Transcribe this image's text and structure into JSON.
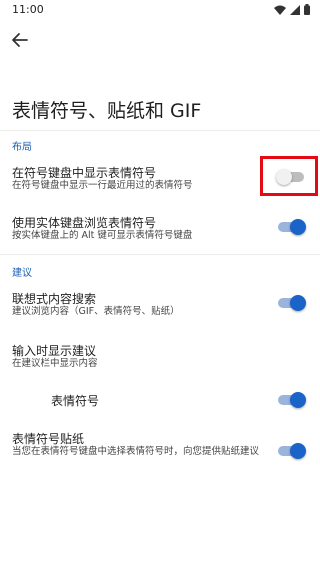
{
  "status": {
    "time": "11:00"
  },
  "page": {
    "title": "表情符号、贴纸和 GIF"
  },
  "sections": {
    "layout": "布局",
    "suggestions": "建议"
  },
  "rows": {
    "show_in_symbol_keyboard": {
      "title": "在符号键盘中显示表情符号",
      "summary": "在符号键盘中显示一行最近用过的表情符号",
      "enabled": false
    },
    "physical_keyboard": {
      "title": "使用实体键盘浏览表情符号",
      "summary": "按实体键盘上的 Alt 键可显示表情符号键盘",
      "enabled": true
    },
    "contextual_search": {
      "title": "联想式内容搜索",
      "summary": "建议浏览内容（GIF、表情符号、贴纸）",
      "enabled": true
    },
    "show_suggestions": {
      "title": "输入时显示建议",
      "summary": "在建议栏中显示内容"
    },
    "emoji_sub": {
      "title": "表情符号",
      "enabled": true
    },
    "emoji_stickers": {
      "title": "表情符号贴纸",
      "summary": "当您在表情符号键盘中选择表情符号时，向您提供贴纸建议",
      "enabled": true
    }
  },
  "colors": {
    "accent": "#1a63c9",
    "section": "#1a5fb4",
    "highlight": "#e50914"
  }
}
